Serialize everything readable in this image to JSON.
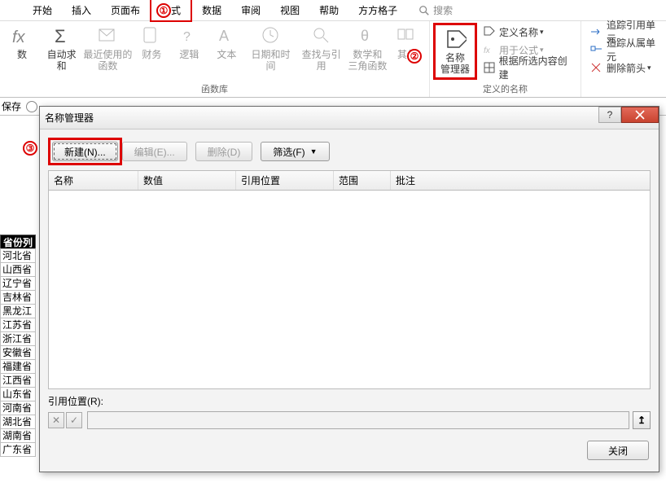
{
  "tabs": {
    "start": "开始",
    "insert": "插入",
    "layout": "页面布",
    "formulas": "公式",
    "data": "数据",
    "review": "审阅",
    "view": "视图",
    "help": "帮助",
    "addon": "方方格子",
    "search": "搜索"
  },
  "ribbon": {
    "fx_label": "数",
    "autosum": "自动求和",
    "recent": "最近使用的\n函数",
    "finance": "财务",
    "logic": "逻辑",
    "text": "文本",
    "datetime": "日期和时间",
    "lookup": "查找与引用",
    "math": "数学和\n三角函数",
    "other": "其他",
    "library_label": "函数库",
    "name_manager": "名称\n管理器",
    "define_name": "定义名称",
    "use_formula": "用于公式",
    "create_from_sel": "根据所选内容创建",
    "names_label": "定义的名称",
    "trace_prec": "追踪引用单元",
    "trace_dep": "追踪从属单元",
    "remove_arrows": "删除箭头"
  },
  "strip": {
    "save": "保存"
  },
  "sheet": {
    "col_header": "省份列",
    "cells": [
      "河北省",
      "山西省",
      "辽宁省",
      "吉林省",
      "黑龙江",
      "江苏省",
      "浙江省",
      "安徽省",
      "福建省",
      "江西省",
      "山东省",
      "河南省",
      "湖北省",
      "湖南省",
      "广东省"
    ]
  },
  "dialog": {
    "title": "名称管理器",
    "new": "新建(N)...",
    "edit": "编辑(E)...",
    "delete": "删除(D)",
    "filter": "筛选(F)",
    "cols": {
      "name": "名称",
      "value": "数值",
      "refers": "引用位置",
      "scope": "范围",
      "comment": "批注"
    },
    "refers_label": "引用位置(R):",
    "close": "关闭"
  },
  "markers": {
    "m1": "①",
    "m2": "②",
    "m3": "③"
  }
}
